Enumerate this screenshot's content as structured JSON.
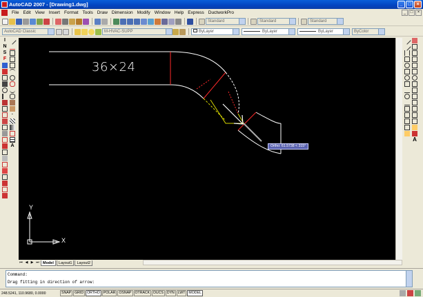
{
  "window": {
    "title": "AutoCAD 2007 - [Drawing1.dwg]",
    "minimize": "_",
    "maximize": "□",
    "close": "×"
  },
  "menu": {
    "items": [
      "File",
      "Edit",
      "View",
      "Insert",
      "Format",
      "Tools",
      "Draw",
      "Dimension",
      "Modify",
      "Window",
      "Help",
      "Express",
      "DuctworkPro"
    ],
    "doc_min": "_",
    "doc_restore": "□",
    "doc_close": "×"
  },
  "toolbar1": {
    "text_style": "Standard",
    "dim_style": "Standard",
    "table_style": "Standard"
  },
  "toolbar2": {
    "workspace": "AutoCAD Classic",
    "layer": "M-HVAC-SUPP",
    "color": "ByLayer",
    "linetype": "ByLayer",
    "lineweight": "ByLayer",
    "plotstyle": "ByColor"
  },
  "drawing": {
    "duct_label": "36×24",
    "tooltip": "Ortho: 61.5738 < 315°",
    "ucs_y": "Y",
    "ucs_x": "X",
    "colors": {
      "background": "#000000",
      "duct": "#ffffff",
      "joint": "#ff2a2a",
      "preview": "#d8d800",
      "arrow": "#ffffff"
    }
  },
  "left_toolbar_icons": [
    "line-icon",
    "xline-icon",
    "polyline-icon",
    "polygon-icon",
    "rectangle-icon",
    "arc-icon",
    "circle-icon",
    "revcloud-icon",
    "spline-icon",
    "ellipse-icon",
    "insert-icon",
    "block-icon",
    "point-icon",
    "hatch-icon",
    "gradient-icon",
    "region-icon",
    "table-icon",
    "mtext-icon"
  ],
  "left_toolbar_letters": [
    "I",
    "N",
    "S",
    "F"
  ],
  "right_toolbar_icons": [
    "erase-icon",
    "copy-icon",
    "mirror-icon",
    "offset-icon",
    "array-icon",
    "move-icon",
    "rotate-icon",
    "scale-icon",
    "stretch-icon",
    "trim-icon",
    "extend-icon",
    "break-icon",
    "join-icon",
    "chamfer-icon",
    "fillet-icon",
    "explode-icon"
  ],
  "right_toolbar_text_glyph": "A",
  "tabs": {
    "nav": [
      "⏮",
      "◀",
      "▶",
      "⏭"
    ],
    "items": [
      "Model",
      "Layout1",
      "Layout2"
    ],
    "active": "Model"
  },
  "command": {
    "line1": "Command:",
    "line2": "Drag fitting in direction of arrow:"
  },
  "status": {
    "coords": "248.5241, 110.9680, 0.0000",
    "toggles": [
      {
        "label": "SNAP",
        "on": false
      },
      {
        "label": "GRID",
        "on": false
      },
      {
        "label": "ORTHO",
        "on": true
      },
      {
        "label": "POLAR",
        "on": false
      },
      {
        "label": "OSNAP",
        "on": false
      },
      {
        "label": "OTRACK",
        "on": false
      },
      {
        "label": "DUCS",
        "on": false
      },
      {
        "label": "DYN",
        "on": false
      },
      {
        "label": "LWT",
        "on": false
      },
      {
        "label": "MODEL",
        "on": true
      }
    ]
  }
}
